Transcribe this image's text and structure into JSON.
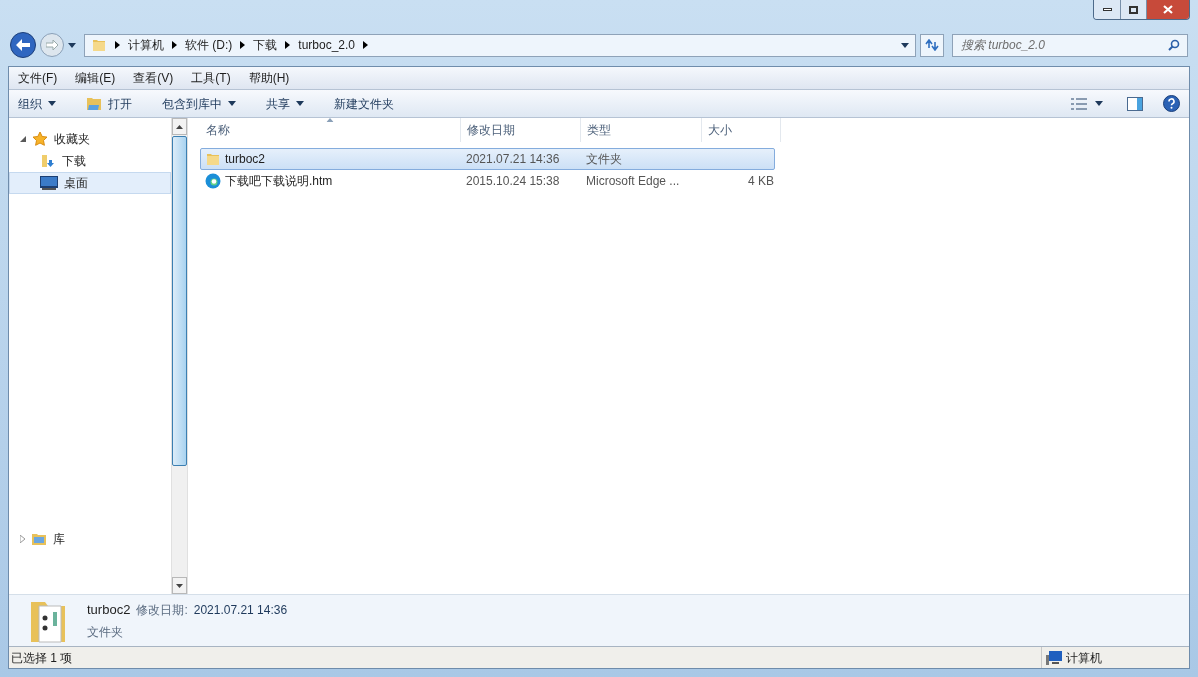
{
  "address_bar": {
    "crumbs": [
      "计算机",
      "软件 (D:)",
      "下载",
      "turboc_2.0"
    ]
  },
  "search": {
    "placeholder": "搜索 turboc_2.0"
  },
  "menu_bar": [
    "文件(F)",
    "编辑(E)",
    "查看(V)",
    "工具(T)",
    "帮助(H)"
  ],
  "toolbar": [
    {
      "label": "组织",
      "kind": "dropdown"
    },
    {
      "label": "打开",
      "kind": "open"
    },
    {
      "label": "包含到库中",
      "kind": "dropdown"
    },
    {
      "label": "共享",
      "kind": "dropdown"
    },
    {
      "label": "新建文件夹",
      "kind": "plain"
    }
  ],
  "sidebar": {
    "items": [
      {
        "label": "收藏夹",
        "kind": "star",
        "expanded": true,
        "selected": false,
        "children": [
          {
            "label": "下载",
            "kind": "download",
            "selected": false
          },
          {
            "label": "桌面",
            "kind": "desktop",
            "selected": true
          }
        ]
      },
      {
        "label": "库",
        "kind": "library",
        "expanded": false,
        "selected": false
      }
    ]
  },
  "table": {
    "columns": [
      {
        "label": "名称",
        "sorted": true
      },
      {
        "label": "修改日期",
        "sorted": false
      },
      {
        "label": "类型",
        "sorted": false
      },
      {
        "label": "大小",
        "sorted": false
      }
    ],
    "rows": [
      {
        "kind": "folder",
        "name": "turboc2",
        "modified": "2021.07.21 14:36",
        "type": "文件夹",
        "selected": true
      },
      {
        "kind": "web",
        "name": "下载吧下载说明.htm",
        "modified": "2015.10.24 15:38",
        "type": "Microsoft Edge ...",
        "size": "4 KB",
        "selected": false
      }
    ]
  },
  "details": {
    "name": "turboc2",
    "modified_label": "修改日期:",
    "modified": "2021.07.21 14:36",
    "type": "文件夹"
  },
  "status_bar": {
    "selection": "已选择 1 项",
    "location": "计算机"
  }
}
